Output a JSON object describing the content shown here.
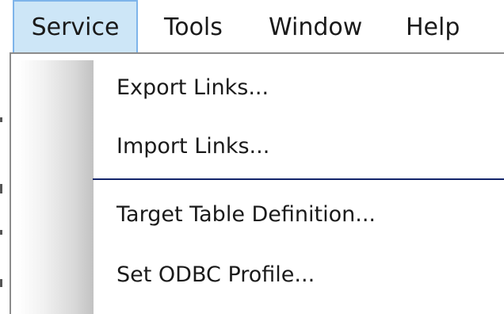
{
  "menubar": {
    "items": [
      {
        "label": "Service",
        "active": true
      },
      {
        "label": "Tools",
        "active": false
      },
      {
        "label": "Window",
        "active": false
      },
      {
        "label": "Help",
        "active": false
      }
    ]
  },
  "dropdown": {
    "items": [
      {
        "label": "Export Links..."
      },
      {
        "label": "Import Links..."
      },
      {
        "label": "Target Table Definition..."
      },
      {
        "label": "Set ODBC Profile..."
      }
    ]
  },
  "colors": {
    "active_menu_bg": "#cde6f7",
    "active_menu_border": "#7eb4ea",
    "separator": "#13246b",
    "text": "#1a1a1a"
  }
}
